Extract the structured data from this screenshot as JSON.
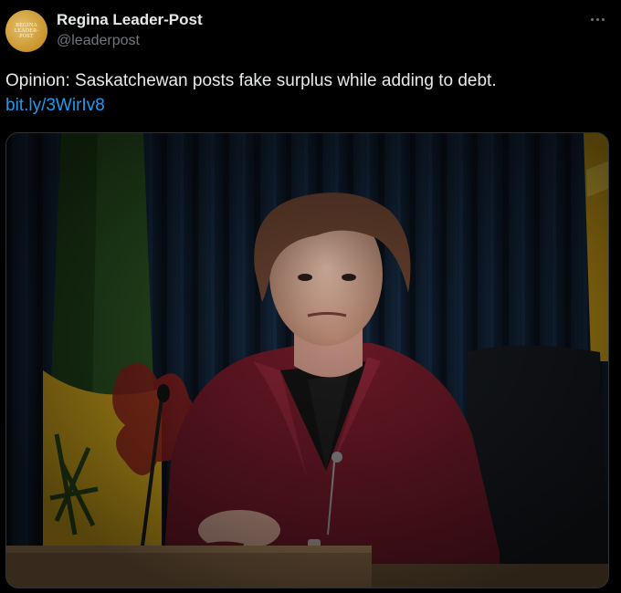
{
  "tweet": {
    "author": {
      "display_name": "Regina Leader-Post",
      "handle": "@leaderpost",
      "avatar_text": "REGINA\nLEADER-POST"
    },
    "text": "Opinion: Saskatchewan posts fake surplus while adding to debt.",
    "link": "bit.ly/3WirIv8",
    "more_icon": "more-horizontal-icon"
  },
  "media": {
    "description_icon": "photo",
    "colors": {
      "background": "#0a0f16",
      "curtain": "#0e1a2a",
      "jacket": "#6b1a27",
      "flag_green": "#2e5a23",
      "flag_yellow": "#e0b41e"
    }
  }
}
